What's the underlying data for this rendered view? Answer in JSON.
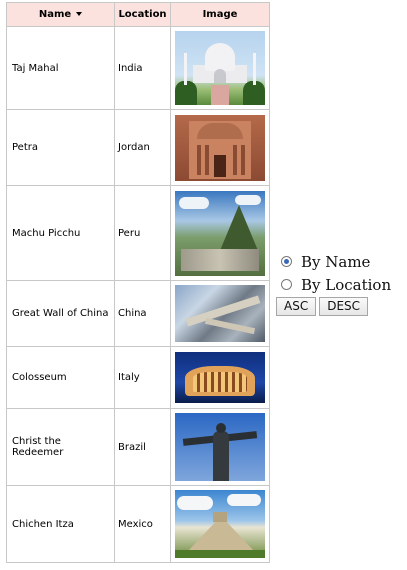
{
  "table": {
    "headers": {
      "name": "Name",
      "location": "Location",
      "image": "Image"
    },
    "sort_icon": "sort-descending-arrow-icon",
    "rows": [
      {
        "name": "Taj Mahal",
        "location": "India"
      },
      {
        "name": "Petra",
        "location": "Jordan"
      },
      {
        "name": "Machu Picchu",
        "location": "Peru"
      },
      {
        "name": "Great Wall of China",
        "location": "China"
      },
      {
        "name": "Colosseum",
        "location": "Italy"
      },
      {
        "name": "Christ the Redeemer",
        "location": "Brazil"
      },
      {
        "name": "Chichen Itza",
        "location": "Mexico"
      }
    ]
  },
  "sort_controls": {
    "options": [
      {
        "label": "By Name",
        "selected": true
      },
      {
        "label": "By Location",
        "selected": false
      }
    ],
    "asc_label": "ASC",
    "desc_label": "DESC"
  },
  "colors": {
    "header_bg": "#fbe2df",
    "border": "#c8c8c8",
    "radio_selected": "#3a67b8"
  }
}
